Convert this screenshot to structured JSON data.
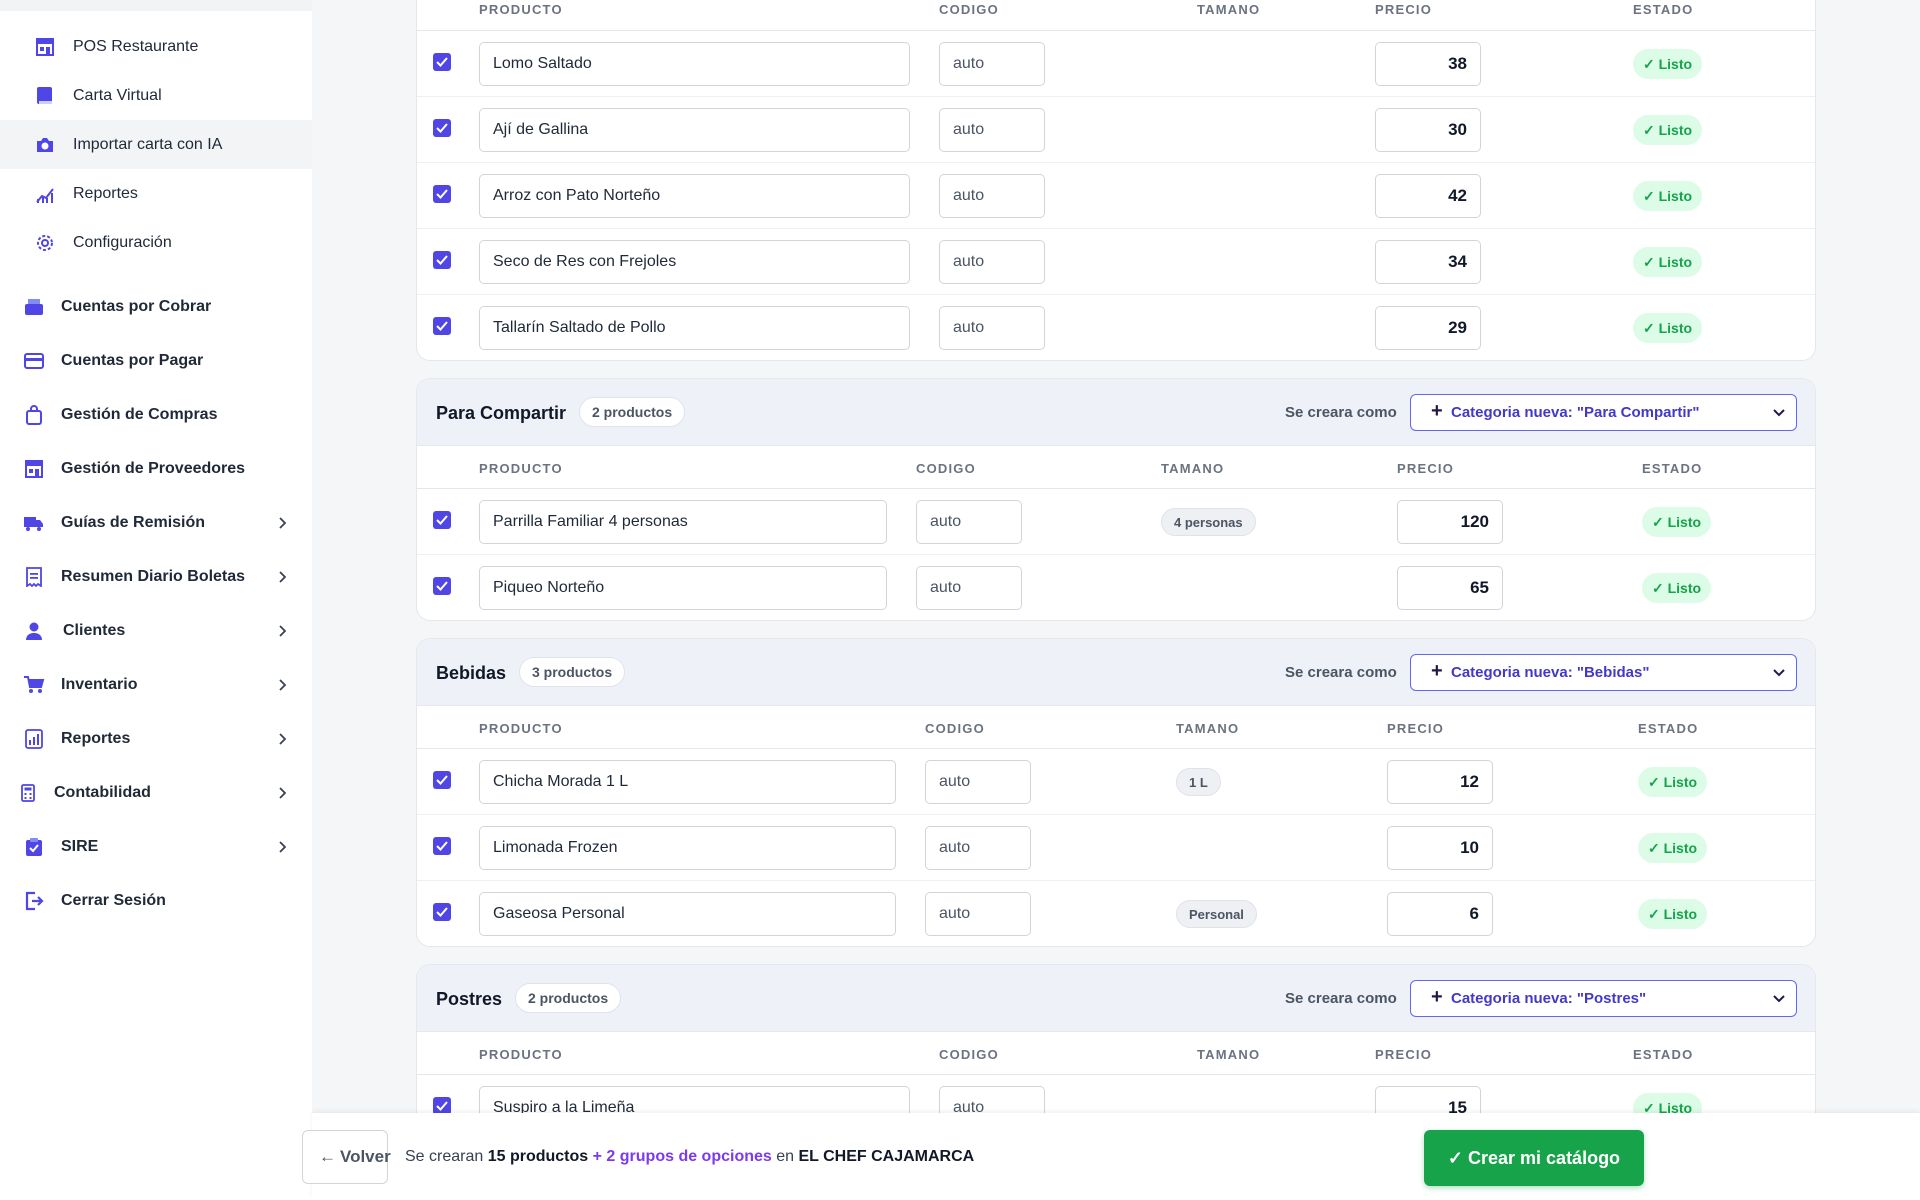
{
  "sidebar": {
    "sub_items": [
      {
        "label": "POS Restaurante",
        "icon": "store-icon"
      },
      {
        "label": "Carta Virtual",
        "icon": "book-icon"
      },
      {
        "label": "Importar carta con IA",
        "icon": "camera-icon",
        "active": true
      },
      {
        "label": "Reportes",
        "icon": "chart-icon"
      },
      {
        "label": "Configuración",
        "icon": "gear-icon"
      }
    ],
    "main_items": [
      {
        "label": "Cuentas por Cobrar",
        "icon": "cash-register-icon"
      },
      {
        "label": "Cuentas por Pagar",
        "icon": "credit-card-icon"
      },
      {
        "label": "Gestión de Compras",
        "icon": "shopping-bag-icon"
      },
      {
        "label": "Gestión de Proveedores",
        "icon": "store-icon"
      },
      {
        "label": "Guías de Remisión",
        "icon": "truck-icon",
        "chevron": true
      },
      {
        "label": "Resumen Diario Boletas",
        "icon": "receipt-icon",
        "chevron": true
      },
      {
        "label": "Clientes",
        "icon": "user-icon",
        "chevron": true
      },
      {
        "label": "Inventario",
        "icon": "cart-icon",
        "chevron": true
      },
      {
        "label": "Reportes",
        "icon": "report-icon",
        "chevron": true
      },
      {
        "label": "Contabilidad",
        "icon": "calculator-icon",
        "chevron": true
      },
      {
        "label": "SIRE",
        "icon": "clipboard-check-icon",
        "chevron": true
      },
      {
        "label": "Cerrar Sesión",
        "icon": "logout-icon"
      }
    ]
  },
  "table_headers": {
    "product": "PRODUCTO",
    "code": "CODIGO",
    "size": "TAMANO",
    "price": "PRECIO",
    "status": "ESTADO"
  },
  "create_as_label": "Se creara como",
  "status_ready": "✓ Listo",
  "code_placeholder": "auto",
  "groups": [
    {
      "title": "",
      "rows": [
        {
          "product": "Lomo Saltado",
          "code": "auto",
          "size": "",
          "price": "38",
          "status": "✓ Listo"
        },
        {
          "product": "Ají de Gallina",
          "code": "auto",
          "size": "",
          "price": "30",
          "status": "✓ Listo"
        },
        {
          "product": "Arroz con Pato Norteño",
          "code": "auto",
          "size": "",
          "price": "42",
          "status": "✓ Listo"
        },
        {
          "product": "Seco de Res con Frejoles",
          "code": "auto",
          "size": "",
          "price": "34",
          "status": "✓ Listo"
        },
        {
          "product": "Tallarín Saltado de Pollo",
          "code": "auto",
          "size": "",
          "price": "29",
          "status": "✓ Listo"
        }
      ]
    },
    {
      "title": "Para Compartir",
      "count": "2 productos",
      "category": "Categoria nueva: \"Para Compartir\"",
      "rows": [
        {
          "product": "Parrilla Familiar 4 personas",
          "code": "auto",
          "size": "4 personas",
          "price": "120",
          "status": "✓ Listo"
        },
        {
          "product": "Piqueo Norteño",
          "code": "auto",
          "size": "",
          "price": "65",
          "status": "✓ Listo"
        }
      ]
    },
    {
      "title": "Bebidas",
      "count": "3 productos",
      "category": "Categoria nueva: \"Bebidas\"",
      "rows": [
        {
          "product": "Chicha Morada 1 L",
          "code": "auto",
          "size": "1 L",
          "price": "12",
          "status": "✓ Listo"
        },
        {
          "product": "Limonada Frozen",
          "code": "auto",
          "size": "",
          "price": "10",
          "status": "✓ Listo"
        },
        {
          "product": "Gaseosa Personal",
          "code": "auto",
          "size": "Personal",
          "price": "6",
          "status": "✓ Listo"
        }
      ]
    },
    {
      "title": "Postres",
      "count": "2 productos",
      "category": "Categoria nueva: \"Postres\"",
      "rows": [
        {
          "product": "Suspiro a la Limeña",
          "code": "auto",
          "size": "",
          "price": "15",
          "status": "✓ Listo"
        }
      ]
    }
  ],
  "bottom": {
    "back_label": "Volver",
    "summary_prefix": "Se crearan",
    "product_count": "15 productos",
    "option_groups": "+ 2 grupos de opciones",
    "summary_in": "en",
    "business_name": "EL CHEF CAJAMARCA",
    "create_button": "✓ Crear mi catálogo"
  },
  "colors": {
    "accent": "#4f46e5",
    "success": "#16a34a",
    "success_bg": "#dcfce7",
    "purple": "#7c3aed"
  }
}
